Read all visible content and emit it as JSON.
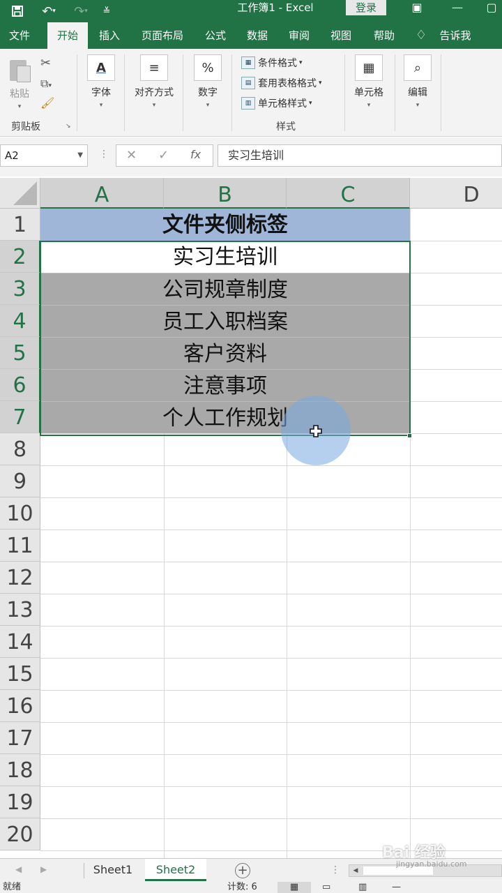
{
  "titlebar": {
    "title": "工作簿1 - Excel",
    "login": "登录",
    "save_icon": "save-icon",
    "undo_icon": "undo-icon",
    "redo_icon": "redo-icon"
  },
  "tabs": [
    "文件",
    "开始",
    "插入",
    "页面布局",
    "公式",
    "数据",
    "审阅",
    "视图",
    "帮助",
    "告诉我"
  ],
  "ribbon": {
    "paste": "粘贴",
    "clipboard": "剪贴板",
    "font": "字体",
    "align": "对齐方式",
    "number": "数字",
    "conditional": "条件格式",
    "table_format": "套用表格格式",
    "cell_style": "单元格样式",
    "styles": "样式",
    "cells": "单元格",
    "edit": "编辑",
    "number_symbol": "%"
  },
  "formula": {
    "namebox": "A2",
    "fx": "fx",
    "content": "实习生培训"
  },
  "grid": {
    "columns": [
      "A",
      "B",
      "C",
      "D"
    ],
    "rows": [
      "1",
      "2",
      "3",
      "4",
      "5",
      "6",
      "7",
      "8",
      "9",
      "10",
      "11",
      "12",
      "13",
      "14",
      "15",
      "16",
      "17",
      "18",
      "19",
      "20"
    ],
    "cells": {
      "r1": "文件夹侧标签",
      "r2": "实习生培训",
      "r3": "公司规章制度",
      "r4": "员工入职档案",
      "r5": "客户资料",
      "r6": "注意事项",
      "r7": "个人工作规划"
    }
  },
  "sheets": {
    "tabs": [
      "Sheet1",
      "Sheet2"
    ],
    "active": "Sheet2"
  },
  "status": {
    "ready": "就绪",
    "count": "计数: 6"
  },
  "watermark": {
    "main": "Bai 经验",
    "sub": "jingyan.baidu.com"
  }
}
